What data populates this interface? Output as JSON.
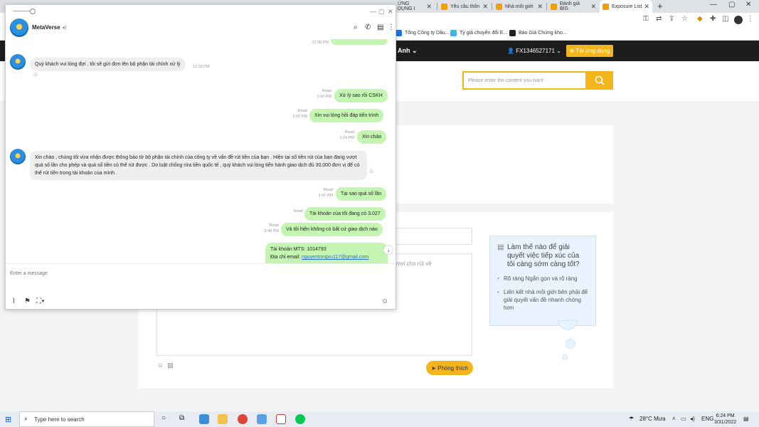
{
  "browser": {
    "tabs": [
      {
        "label": "ỨNG DỤNG I",
        "active": false
      },
      {
        "label": "Yêu cầu thôn",
        "active": false
      },
      {
        "label": "Nhà môi giới",
        "active": false
      },
      {
        "label": "Đánh giá BIG",
        "active": false
      },
      {
        "label": "Exposure List",
        "active": true
      }
    ],
    "bookmarks": [
      {
        "label": "Tổng Công ty Dầu..."
      },
      {
        "label": "Tỷ giá chuyển đổi E..."
      },
      {
        "label": "Báo Giá Chứng kho..."
      }
    ]
  },
  "website": {
    "language": "Anh",
    "user_id": "FX1346527171",
    "register_label": "Tải ứng dụng",
    "search_placeholder": "Please enter the content you want",
    "textarea_snippet": "mvi cho rút về",
    "feedback_button": "Phòng thích",
    "tip_title": "Làm thế nào để giải quyết việc tiếp xúc của tôi càng sớm càng tốt?",
    "tip_items": [
      "Rõ ràng Ngắn gọn và rõ ràng",
      "Liên kết nhà môi giới bên phải để giải quyết vấn đề nhanh chóng hơn"
    ]
  },
  "chat": {
    "contact_name": "MetaVerse",
    "compose_placeholder": "Enter a message",
    "messages": [
      {
        "dir": "in",
        "text": "Quý khách vui lòng đợi , tôi sẽ gửi đơn lên bộ phận tài chính xử lý",
        "time": "12:39 PM"
      },
      {
        "dir": "out",
        "status": "Read",
        "time": "1:10 PM",
        "text": "Xử lý sao rồi CSKH"
      },
      {
        "dir": "out",
        "status": "Read",
        "time": "2:02 PM",
        "text": "Xin vui lòng hồi đáp tiến trình"
      },
      {
        "dir": "out",
        "status": "Read",
        "time": "2:24 PM",
        "text": "Xin chào"
      },
      {
        "dir": "in",
        "text": "Xin chào , chúng tôi vừa nhận được thông báo từ bộ phận tài chính của công ty về vấn đề rút tiền của bạn . Hiện tại số tiền rút của bạn đang vượt quá số lần cho phép và quá số tiền có thể rút được . Do luật chống rửa tiền quốc tế , quý khách vui lòng tiến hành giao dịch đủ 30.000 đơn vị để có thể rút tiền trong tài khoản của mình ."
      },
      {
        "dir": "out",
        "status": "Read",
        "time": "2:47 PM",
        "text": "Tại sao quá số lần"
      },
      {
        "dir": "out",
        "status": "Read",
        "time": "",
        "text": "Tài khoản của tôi đang có 3.027"
      },
      {
        "dir": "out",
        "status": "Read",
        "time": "2:48 PM",
        "text": "Và tôi hiện không có bất cứ giao dịch nào"
      },
      {
        "dir": "out",
        "status": "",
        "time": "",
        "text": "Tài khoản MTS: 1014793",
        "email_label": "Địa chỉ email:",
        "email": "nguyentongxu117@gmail.com"
      }
    ],
    "prev_time": "12:38 PM"
  },
  "taskbar": {
    "search_placeholder": "Type here to search",
    "weather": "28°C  Mưa",
    "lang": "ENG",
    "time": "6:24 PM",
    "date": "3/31/2022"
  }
}
